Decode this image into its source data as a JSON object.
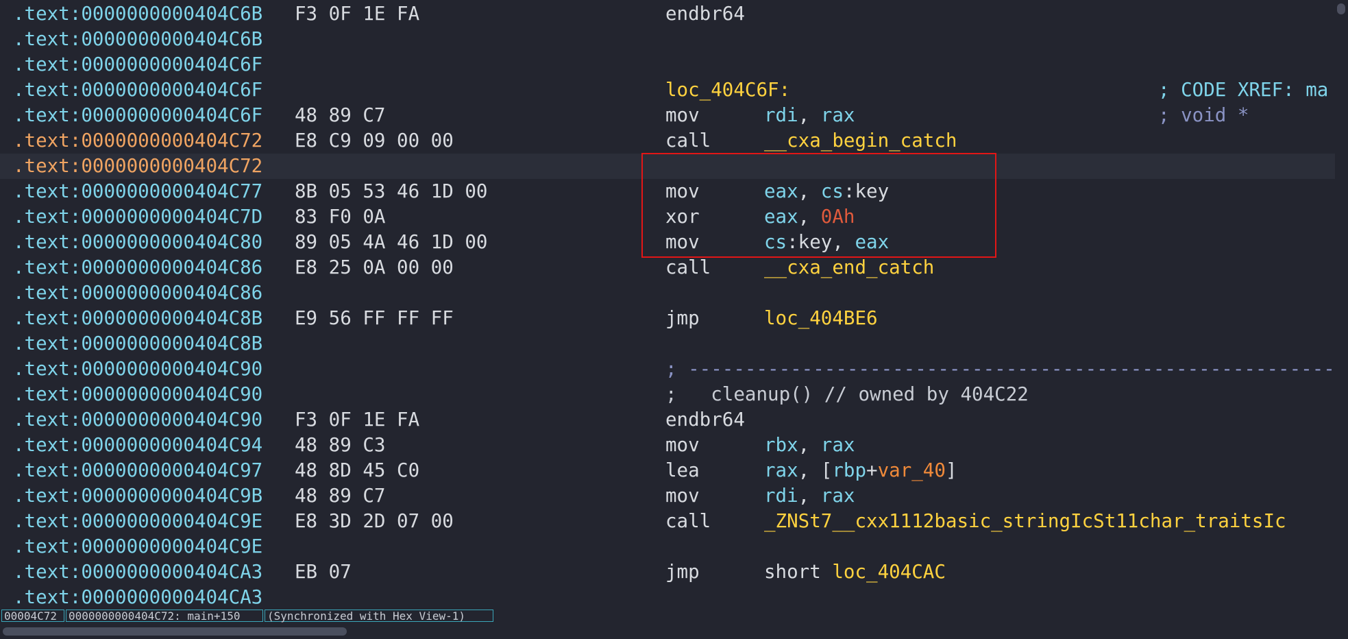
{
  "listing": [
    {
      "addr": ".text:0000000000404C6B",
      "bytes": "F3 0F 1E FA",
      "mnem": "endbr64",
      "ops": []
    },
    {
      "addr": ".text:0000000000404C6B"
    },
    {
      "addr": ".text:0000000000404C6F"
    },
    {
      "addr": ".text:0000000000404C6F",
      "label": "loc_404C6F:",
      "comment": "; CODE XREF: ma"
    },
    {
      "addr": ".text:0000000000404C6F",
      "bytes": "48 89 C7",
      "mnem": "mov",
      "ops": [
        {
          "t": "rdi",
          "c": "reg"
        },
        {
          "t": ", "
        },
        {
          "t": "rax",
          "c": "reg"
        }
      ],
      "comment": "; void *",
      "comment_dim": true
    },
    {
      "addr": ".text:0000000000404C72",
      "bytes": "E8 C9 09 00 00",
      "mnem": "call",
      "ops": [
        {
          "t": "__cxa_begin_catch",
          "c": "name"
        }
      ],
      "cur_addr": true
    },
    {
      "addr": ".text:0000000000404C72",
      "cur_addr": true,
      "cur_row": true
    },
    {
      "addr": ".text:0000000000404C77",
      "bytes": "8B 05 53 46 1D 00",
      "mnem": "mov",
      "ops": [
        {
          "t": "eax",
          "c": "reg"
        },
        {
          "t": ", "
        },
        {
          "t": "cs",
          "c": "reg"
        },
        {
          "t": ":key"
        }
      ]
    },
    {
      "addr": ".text:0000000000404C7D",
      "bytes": "83 F0 0A",
      "mnem": "xor",
      "ops": [
        {
          "t": "eax",
          "c": "reg"
        },
        {
          "t": ", "
        },
        {
          "t": "0Ah",
          "c": "num"
        }
      ]
    },
    {
      "addr": ".text:0000000000404C80",
      "bytes": "89 05 4A 46 1D 00",
      "mnem": "mov",
      "ops": [
        {
          "t": "cs",
          "c": "reg"
        },
        {
          "t": ":key, "
        },
        {
          "t": "eax",
          "c": "reg"
        }
      ]
    },
    {
      "addr": ".text:0000000000404C86",
      "bytes": "E8 25 0A 00 00",
      "mnem": "call",
      "ops": [
        {
          "t": "__cxa_end_catch",
          "c": "name"
        }
      ]
    },
    {
      "addr": ".text:0000000000404C86"
    },
    {
      "addr": ".text:0000000000404C8B",
      "bytes": "E9 56 FF FF FF",
      "mnem": "jmp",
      "ops": [
        {
          "t": "loc_404BE6",
          "c": "name"
        }
      ]
    },
    {
      "addr": ".text:0000000000404C8B"
    },
    {
      "addr": ".text:0000000000404C90",
      "separator": "; ---------------------------------------------------------------"
    },
    {
      "addr": ".text:0000000000404C90",
      "line_comment": ";   cleanup() // owned by 404C22"
    },
    {
      "addr": ".text:0000000000404C90",
      "bytes": "F3 0F 1E FA",
      "mnem": "endbr64",
      "ops": []
    },
    {
      "addr": ".text:0000000000404C94",
      "bytes": "48 89 C3",
      "mnem": "mov",
      "ops": [
        {
          "t": "rbx",
          "c": "reg"
        },
        {
          "t": ", "
        },
        {
          "t": "rax",
          "c": "reg"
        }
      ]
    },
    {
      "addr": ".text:0000000000404C97",
      "bytes": "48 8D 45 C0",
      "mnem": "lea",
      "ops": [
        {
          "t": "rax",
          "c": "reg"
        },
        {
          "t": ", ["
        },
        {
          "t": "rbp",
          "c": "reg"
        },
        {
          "t": "+"
        },
        {
          "t": "var_40",
          "c": "var"
        },
        {
          "t": "]"
        }
      ]
    },
    {
      "addr": ".text:0000000000404C9B",
      "bytes": "48 89 C7",
      "mnem": "mov",
      "ops": [
        {
          "t": "rdi",
          "c": "reg"
        },
        {
          "t": ", "
        },
        {
          "t": "rax",
          "c": "reg"
        }
      ]
    },
    {
      "addr": ".text:0000000000404C9E",
      "bytes": "E8 3D 2D 07 00",
      "mnem": "call",
      "ops": [
        {
          "t": "_ZNSt7__cxx1112basic_stringIcSt11char_traitsIc",
          "c": "name"
        }
      ]
    },
    {
      "addr": ".text:0000000000404C9E"
    },
    {
      "addr": ".text:0000000000404CA3",
      "bytes": "EB 07",
      "mnem": "jmp",
      "ops": [
        {
          "t": "short "
        },
        {
          "t": "loc_404CAC",
          "c": "name"
        }
      ]
    },
    {
      "addr": ".text:0000000000404CA3"
    }
  ],
  "status": {
    "offset": "00004C72",
    "location": "0000000000404C72: main+150",
    "sync": "(Synchronized with Hex View-1)"
  }
}
